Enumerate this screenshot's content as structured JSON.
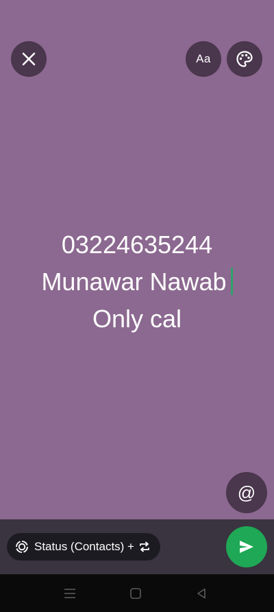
{
  "editor": {
    "background_color": "#8c6990",
    "lines": [
      "03224635244",
      "Munawar Nawab",
      "Only cal"
    ],
    "cursor_color": "#2fa36b"
  },
  "toolbar": {
    "close_icon": "close-icon",
    "font_label": "Aa",
    "palette_icon": "palette-icon"
  },
  "mention": {
    "icon": "at-icon",
    "glyph": "@"
  },
  "footer": {
    "audience_label": "Status (Contacts) +",
    "send_color": "#1fa855"
  },
  "navigation": {
    "items": [
      "menu-icon",
      "home-icon",
      "back-icon"
    ]
  }
}
